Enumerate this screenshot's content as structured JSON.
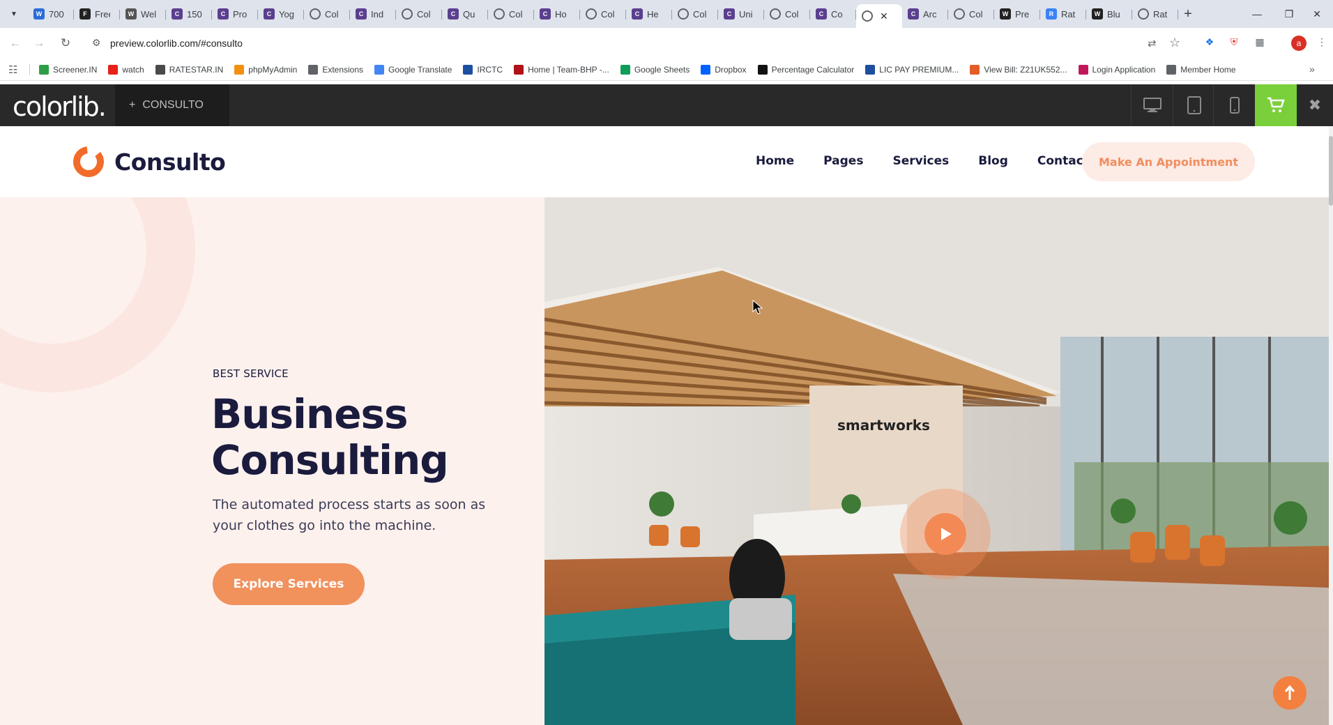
{
  "browser": {
    "tabs": [
      {
        "title": "700",
        "icon": "W",
        "color": "#2b6cd8"
      },
      {
        "title": "Free",
        "icon": "F",
        "color": "#222222"
      },
      {
        "title": "Wel",
        "icon": "wix",
        "color": "#555555"
      },
      {
        "title": "150",
        "icon": "c",
        "color": "#5b3f8f"
      },
      {
        "title": "Pro",
        "icon": "c",
        "color": "#5b3f8f"
      },
      {
        "title": "Yog",
        "icon": "c",
        "color": "#5b3f8f"
      },
      {
        "title": "Col",
        "icon": "globe",
        "color": "#5f6368"
      },
      {
        "title": "Ind",
        "icon": "c",
        "color": "#5b3f8f"
      },
      {
        "title": "Col",
        "icon": "globe",
        "color": "#5f6368"
      },
      {
        "title": "Qu",
        "icon": "c",
        "color": "#5b3f8f"
      },
      {
        "title": "Col",
        "icon": "globe",
        "color": "#5f6368"
      },
      {
        "title": "Ho",
        "icon": "c",
        "color": "#5b3f8f"
      },
      {
        "title": "Col",
        "icon": "globe",
        "color": "#5f6368"
      },
      {
        "title": "He",
        "icon": "c",
        "color": "#5b3f8f"
      },
      {
        "title": "Col",
        "icon": "globe",
        "color": "#5f6368"
      },
      {
        "title": "Uni",
        "icon": "c",
        "color": "#5b3f8f"
      },
      {
        "title": "Col",
        "icon": "globe",
        "color": "#5f6368"
      },
      {
        "title": "Co",
        "icon": "c",
        "color": "#5b3f8f"
      },
      {
        "title": "",
        "icon": "globe",
        "color": "#5f6368",
        "active": true
      },
      {
        "title": "Arc",
        "icon": "c",
        "color": "#5b3f8f"
      },
      {
        "title": "Col",
        "icon": "globe",
        "color": "#5f6368"
      },
      {
        "title": "Pre",
        "icon": "W",
        "color": "#222222"
      },
      {
        "title": "Rat",
        "icon": "r",
        "color": "#3b82f6"
      },
      {
        "title": "Blu",
        "icon": "W",
        "color": "#222222"
      },
      {
        "title": "Rat",
        "icon": "globe",
        "color": "#5f6368"
      }
    ],
    "url": "preview.colorlib.com/#consulto",
    "profile_initial": "a",
    "bookmarks": [
      {
        "label": "Screener.IN",
        "color": "#2e9e44"
      },
      {
        "label": "watch",
        "color": "#e62117"
      },
      {
        "label": "RATESTAR.IN",
        "color": "#4a4a4a"
      },
      {
        "label": "phpMyAdmin",
        "color": "#f29111"
      },
      {
        "label": "Extensions",
        "color": "#5f6368"
      },
      {
        "label": "Google Translate",
        "color": "#4285f4"
      },
      {
        "label": "IRCTC",
        "color": "#1c4fa1"
      },
      {
        "label": "Home | Team-BHP -...",
        "color": "#b0121a"
      },
      {
        "label": "Google Sheets",
        "color": "#0f9d58"
      },
      {
        "label": "Dropbox",
        "color": "#0061fe"
      },
      {
        "label": "Percentage Calculator",
        "color": "#111111"
      },
      {
        "label": "LIC PAY PREMIUM...",
        "color": "#1d4ea0"
      },
      {
        "label": "View Bill: Z21UK552...",
        "color": "#e35d28"
      },
      {
        "label": "Login Application",
        "color": "#c2185b"
      },
      {
        "label": "Member Home",
        "color": "#5f6368"
      }
    ]
  },
  "colorlib_bar": {
    "logo": "colorlib.",
    "theme_label": "CONSULTO",
    "theme_prefix": "+",
    "accent": "#7ad03a"
  },
  "site": {
    "brand": "Consulto",
    "nav": [
      "Home",
      "Pages",
      "Services",
      "Blog",
      "Contact"
    ],
    "cta": "Make An Appointment",
    "accent": "#f1915c"
  },
  "hero": {
    "eyebrow": "BEST SERVICE",
    "title": "Business Consulting",
    "subtitle": "The automated process starts as soon as your clothes go into the machine.",
    "button": "Explore Services",
    "image_sign": "smartworks"
  }
}
